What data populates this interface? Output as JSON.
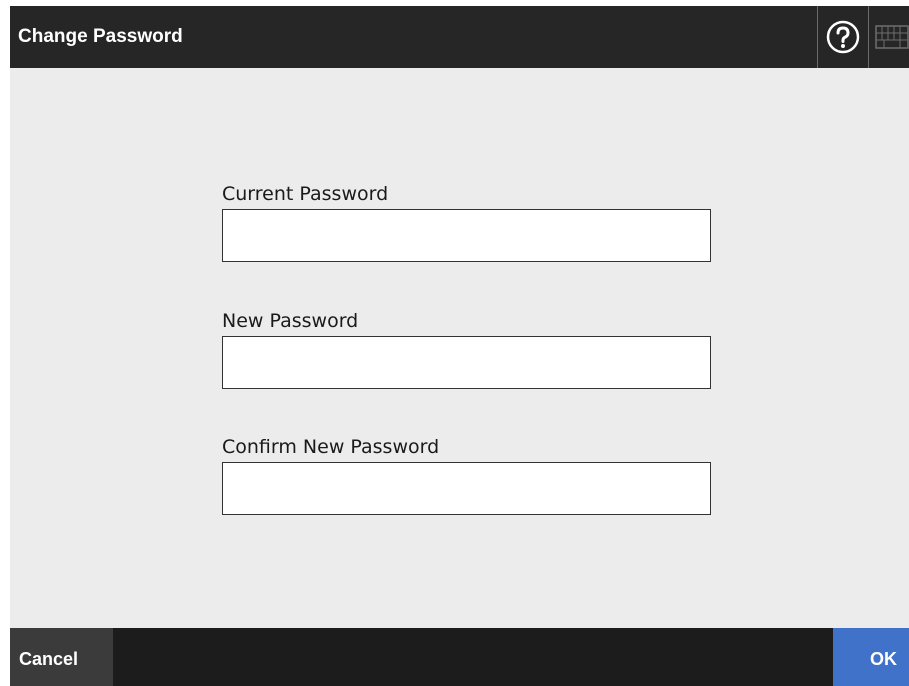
{
  "header": {
    "title": "Change Password",
    "help_icon": "help-question-icon",
    "keyboard_icon": "keyboard-icon"
  },
  "form": {
    "current_password": {
      "label": "Current Password",
      "value": ""
    },
    "new_password": {
      "label": "New Password",
      "value": ""
    },
    "confirm_password": {
      "label": "Confirm New Password",
      "value": ""
    }
  },
  "footer": {
    "cancel_label": "Cancel",
    "ok_label": "OK"
  },
  "colors": {
    "header_bg": "#262626",
    "content_bg": "#ececec",
    "footer_bg": "#1c1c1c",
    "cancel_bg": "#3b3b3b",
    "ok_bg": "#3f72c8"
  }
}
